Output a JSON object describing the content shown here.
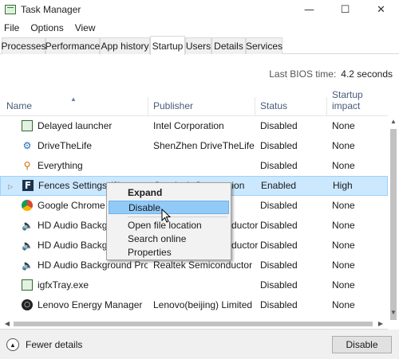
{
  "window": {
    "title": "Task Manager",
    "minimize": "—",
    "maximize": "☐",
    "close": "✕",
    "icon": "task-manager-icon"
  },
  "menu": [
    "File",
    "Options",
    "View"
  ],
  "tabs": [
    "Processes",
    "Performance",
    "App history",
    "Startup",
    "Users",
    "Details",
    "Services"
  ],
  "active_tab": "Startup",
  "bios": {
    "label": "Last BIOS time:",
    "value": "4.2 seconds"
  },
  "columns": {
    "name": "Name",
    "publisher": "Publisher",
    "status": "Status",
    "impact": "Startup impact"
  },
  "rows": [
    {
      "name": "Delayed launcher",
      "publisher": "Intel Corporation",
      "status": "Disabled",
      "impact": "None",
      "icon": "app-window-icon"
    },
    {
      "name": "DriveTheLife",
      "publisher": "ShenZhen DriveTheLife S...",
      "status": "Disabled",
      "impact": "None",
      "icon": "gear-icon"
    },
    {
      "name": "Everything",
      "publisher": "",
      "status": "Disabled",
      "impact": "None",
      "icon": "magnifier-icon"
    },
    {
      "name": "Fences Settings (2)",
      "publisher": "Stardock Corporation",
      "status": "Enabled",
      "impact": "High",
      "icon": "fences-icon"
    },
    {
      "name": "Google Chrome",
      "publisher": "",
      "status": "Disabled",
      "impact": "None",
      "icon": "chrome-icon"
    },
    {
      "name": "HD Audio Backgro",
      "publisher": "ductor",
      "status": "Disabled",
      "impact": "None",
      "icon": "speaker-icon"
    },
    {
      "name": "HD Audio Backgro",
      "publisher": "ductor",
      "status": "Disabled",
      "impact": "None",
      "icon": "speaker-icon"
    },
    {
      "name": "HD Audio Background Pro...",
      "publisher": "Realtek Semiconductor",
      "status": "Disabled",
      "impact": "None",
      "icon": "speaker-icon"
    },
    {
      "name": "igfxTray.exe",
      "publisher": "",
      "status": "Disabled",
      "impact": "None",
      "icon": "app-window-icon"
    },
    {
      "name": "Lenovo Energy Manager",
      "publisher": "Lenovo(beijing) Limited",
      "status": "Disabled",
      "impact": "None",
      "icon": "lenovo-icon"
    }
  ],
  "context_menu": [
    "Expand",
    "Disable",
    "Open file location",
    "Search online",
    "Properties"
  ],
  "footer": {
    "fewer_details": "Fewer details",
    "disable_button": "Disable"
  }
}
